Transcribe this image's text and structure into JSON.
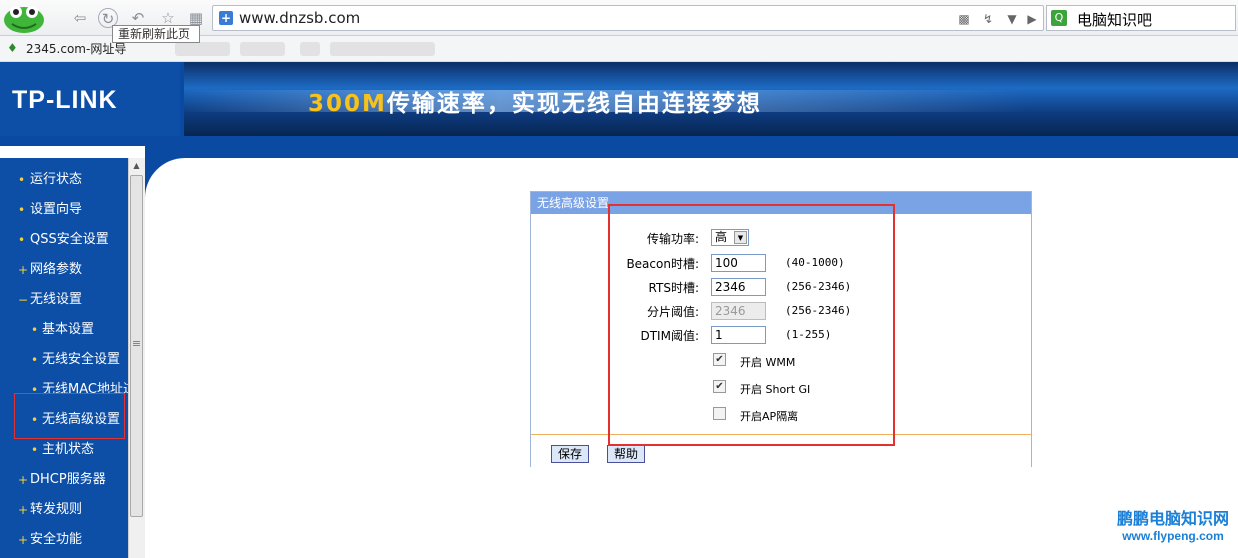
{
  "browser": {
    "address": "www.dnzsb.com",
    "address_icon": "+",
    "search_text": "电脑知识吧",
    "tooltip": "重新刷新此页",
    "bookmark": "2345.com-网址导"
  },
  "icons": [
    "back-icon",
    "refresh-icon",
    "undo-icon",
    "star-icon",
    "grid-icon",
    "qr-icon",
    "lightning-icon",
    "dropdown-icon",
    "play-icon",
    "search-icon"
  ],
  "header": {
    "logo": "TP-LINK",
    "slogan_num": "300M",
    "slogan_text": "传输速率，实现无线自由连接梦想"
  },
  "menu": [
    {
      "label": "运行状态",
      "bullet": "•"
    },
    {
      "label": "设置向导",
      "bullet": "•"
    },
    {
      "label": "QSS安全设置",
      "bullet": "•"
    },
    {
      "label": "网络参数",
      "bullet": "+"
    },
    {
      "label": "无线设置",
      "bullet": "−"
    },
    {
      "label": "基本设置",
      "bullet": "•"
    },
    {
      "label": "无线安全设置",
      "bullet": "•"
    },
    {
      "label": "无线MAC地址过滤",
      "bullet": "•"
    },
    {
      "label": "无线高级设置",
      "bullet": "•"
    },
    {
      "label": "主机状态",
      "bullet": "•"
    },
    {
      "label": "DHCP服务器",
      "bullet": "+"
    },
    {
      "label": "转发规则",
      "bullet": "+"
    },
    {
      "label": "安全功能",
      "bullet": "+"
    }
  ],
  "panel": {
    "title": "无线高级设置",
    "power_label": "传输功率:",
    "power_value": "高",
    "beacon_label": "Beacon时槽:",
    "beacon_value": "100",
    "beacon_range": "(40-1000)",
    "rts_label": "RTS时槽:",
    "rts_value": "2346",
    "rts_range": "(256-2346)",
    "frag_label": "分片阈值:",
    "frag_value": "2346",
    "frag_range": "(256-2346)",
    "dtim_label": "DTIM阈值:",
    "dtim_value": "1",
    "dtim_range": "(1-255)",
    "wmm_label": "开启 WMM",
    "wmm_checked": true,
    "sgi_label": "开启 Short GI",
    "sgi_checked": true,
    "ap_label": "开启AP隔离",
    "ap_checked": false,
    "save_label": "保存",
    "help_label": "帮助"
  },
  "watermark": {
    "line1": "鹏鹏电脑知识网",
    "line2": "www.flypeng.com"
  },
  "colors": {
    "brand_blue": "#0b4aa2",
    "highlight_red": "#e53030",
    "panel_title": "#7aa3e6"
  }
}
